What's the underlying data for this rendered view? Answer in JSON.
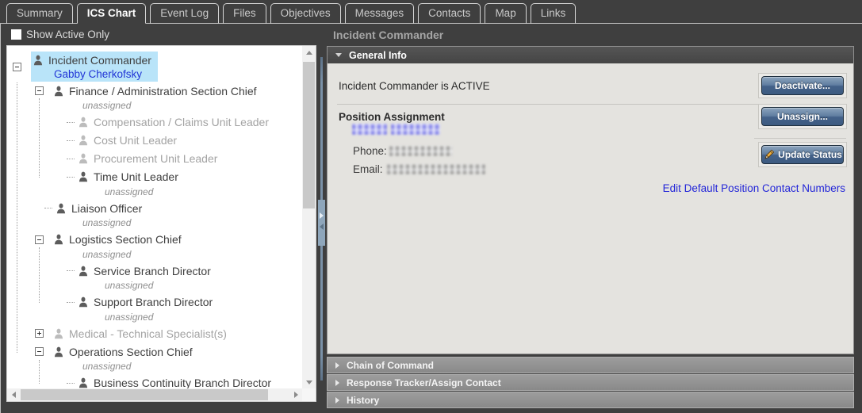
{
  "tabs": [
    {
      "label": "Summary",
      "active": false
    },
    {
      "label": "ICS Chart",
      "active": true
    },
    {
      "label": "Event Log",
      "active": false
    },
    {
      "label": "Files",
      "active": false
    },
    {
      "label": "Objectives",
      "active": false
    },
    {
      "label": "Messages",
      "active": false
    },
    {
      "label": "Contacts",
      "active": false
    },
    {
      "label": "Map",
      "active": false
    },
    {
      "label": "Links",
      "active": false
    }
  ],
  "filter": {
    "label": "Show Active Only",
    "checked": false
  },
  "tree": {
    "items": [
      {
        "label": "Incident Commander",
        "level": 0,
        "expander": "minus",
        "icon": "dark",
        "selected": true,
        "assignee": "Gabby Cherkofsky"
      },
      {
        "label": "Finance / Administration Section Chief",
        "level": 1,
        "expander": "minus",
        "icon": "dark",
        "sub": "unassigned"
      },
      {
        "label": "Compensation / Claims Unit Leader",
        "level": 2,
        "expander": "none",
        "icon": "light",
        "muted": true
      },
      {
        "label": "Cost Unit Leader",
        "level": 2,
        "expander": "none",
        "icon": "light",
        "muted": true
      },
      {
        "label": "Procurement Unit Leader",
        "level": 2,
        "expander": "none",
        "icon": "light",
        "muted": true
      },
      {
        "label": "Time Unit Leader",
        "level": 2,
        "expander": "none",
        "icon": "dark",
        "sub": "unassigned"
      },
      {
        "label": "Liaison Officer",
        "level": 1,
        "expander": "none",
        "icon": "dark",
        "sub": "unassigned"
      },
      {
        "label": "Logistics Section Chief",
        "level": 1,
        "expander": "minus",
        "icon": "dark",
        "sub": "unassigned"
      },
      {
        "label": "Service Branch Director",
        "level": 2,
        "expander": "none",
        "icon": "dark",
        "sub": "unassigned"
      },
      {
        "label": "Support Branch Director",
        "level": 2,
        "expander": "none",
        "icon": "dark",
        "sub": "unassigned"
      },
      {
        "label": "Medical - Technical Specialist(s)",
        "level": 1,
        "expander": "plus",
        "icon": "light",
        "muted": true
      },
      {
        "label": "Operations Section Chief",
        "level": 1,
        "expander": "minus",
        "icon": "dark",
        "sub": "unassigned"
      },
      {
        "label": "Business Continuity Branch Director",
        "level": 2,
        "expander": "none",
        "icon": "dark"
      }
    ]
  },
  "panel": {
    "title": "Incident Commander",
    "general_info": {
      "header": "General Info",
      "status_text": "Incident Commander is ACTIVE",
      "deactivate_label": "Deactivate...",
      "assignment_heading": "Position Assignment",
      "unassign_label": "Unassign...",
      "phone_label": "Phone:",
      "email_label": "Email:",
      "update_status_label": "Update Status",
      "edit_link": "Edit Default Position Contact Numbers"
    },
    "collapsed_sections": [
      {
        "label": "Chain of Command"
      },
      {
        "label": "Response Tracker/Assign Contact"
      },
      {
        "label": "History"
      }
    ]
  },
  "colors": {
    "selection_highlight": "#b9e4f9",
    "link_blue": "#2326d8",
    "tree_assignee_blue": "#2135d6",
    "button_top": "#8ca4bd",
    "button_bottom": "#3c5a80",
    "content_bg": "#e4e3df",
    "chrome_bg": "#3f3f3f"
  }
}
